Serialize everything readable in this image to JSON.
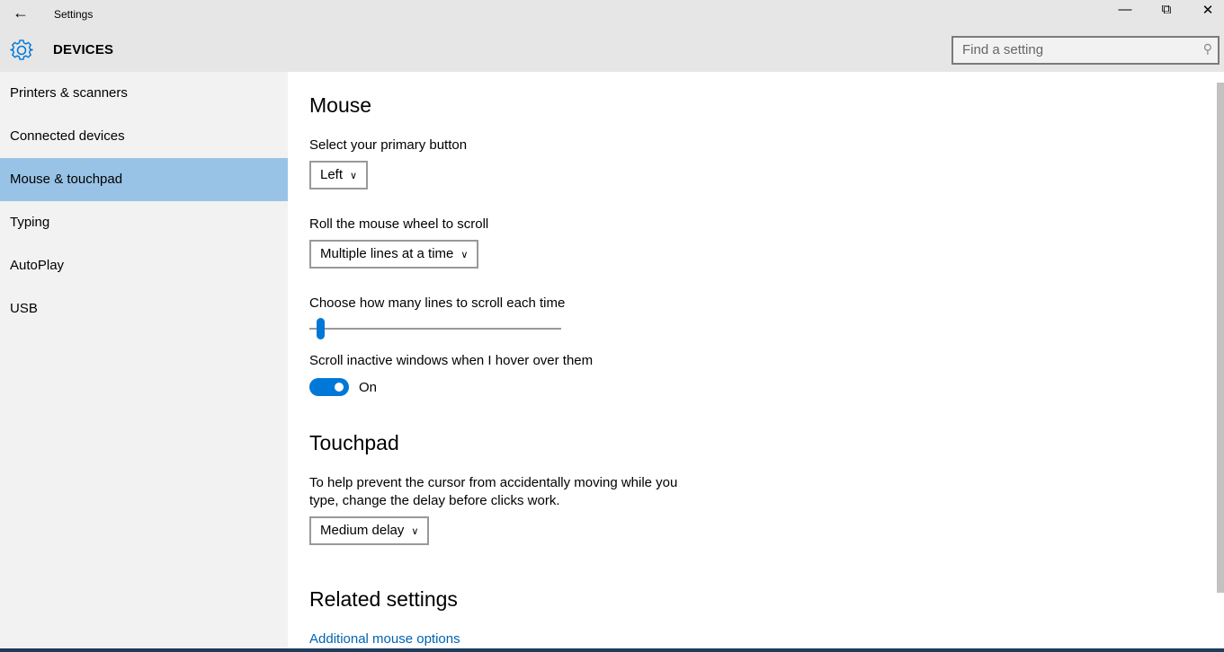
{
  "window": {
    "title": "Settings",
    "back_icon": "arrow-left-icon",
    "minimize_icon": "minimize-icon",
    "restore_icon": "restore-icon",
    "close_icon": "close-icon"
  },
  "header": {
    "section": "DEVICES",
    "icon": "gear-icon",
    "search_placeholder": "Find a setting"
  },
  "sidebar": {
    "items": [
      {
        "label": "Printers & scanners"
      },
      {
        "label": "Connected devices"
      },
      {
        "label": "Mouse & touchpad",
        "selected": true
      },
      {
        "label": "Typing"
      },
      {
        "label": "AutoPlay"
      },
      {
        "label": "USB"
      }
    ]
  },
  "mouse": {
    "title": "Mouse",
    "primary_label": "Select your primary button",
    "primary_value": "Left",
    "wheel_label": "Roll the mouse wheel to scroll",
    "wheel_value": "Multiple lines at a time",
    "lines_label": "Choose how many lines to scroll each time",
    "lines_slider_fraction": 0.03,
    "inactive_label": "Scroll inactive windows when I hover over them",
    "inactive_state": "On"
  },
  "touchpad": {
    "title": "Touchpad",
    "delay_line1": "To help prevent the cursor from accidentally moving while you",
    "delay_line2": "type, change the delay before clicks work.",
    "delay_value": "Medium delay"
  },
  "related": {
    "title": "Related settings",
    "link": "Additional mouse options"
  },
  "colors": {
    "accent": "#0078d7",
    "selected": "#99c3e6",
    "link": "#0063b1"
  }
}
